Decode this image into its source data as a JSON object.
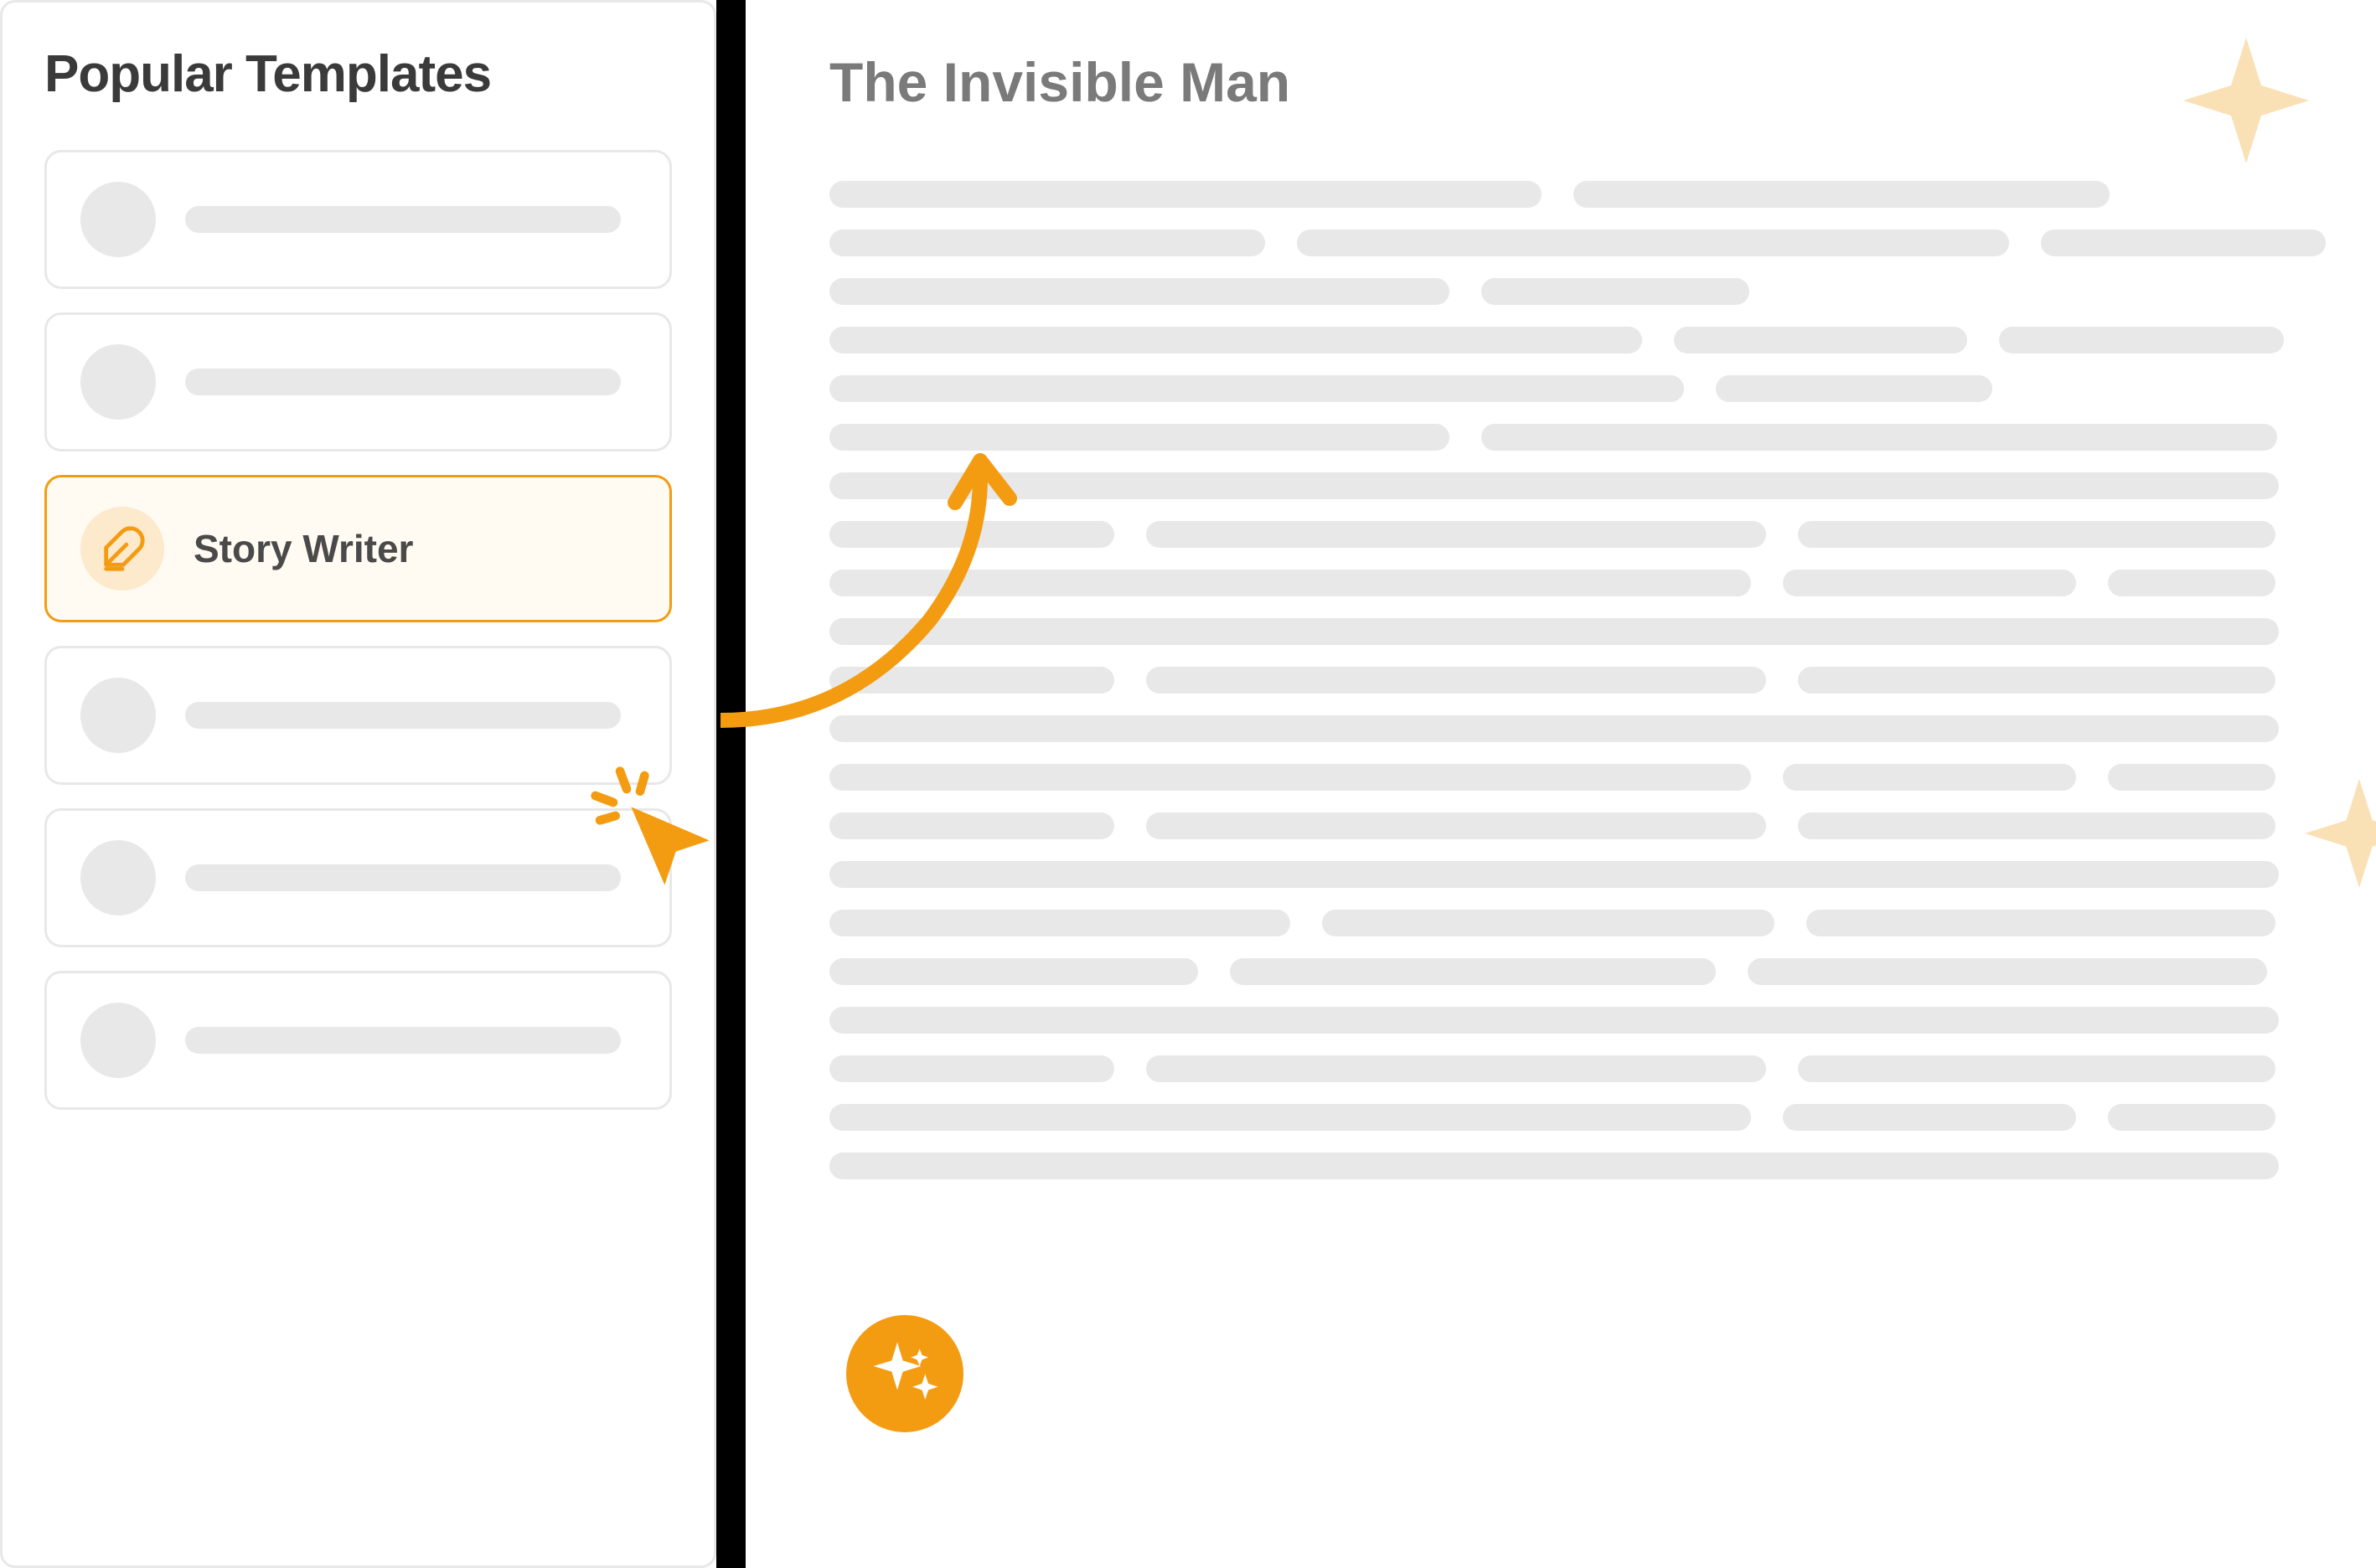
{
  "sidebar": {
    "title": "Popular Templates",
    "items": [
      {
        "label": "",
        "active": false
      },
      {
        "label": "",
        "active": false
      },
      {
        "label": "Story Writer",
        "active": true,
        "icon": "feather-quill-icon"
      },
      {
        "label": "",
        "active": false
      },
      {
        "label": "",
        "active": false
      },
      {
        "label": "",
        "active": false
      }
    ]
  },
  "content": {
    "title": "The Invisible Man"
  },
  "colors": {
    "accent": "#f39c12",
    "accent_light": "#fde9cc",
    "placeholder": "#e8e8e8",
    "star_cream": "#fae0b5",
    "text_dark": "#3a3a3a",
    "text_muted": "#7a7a7a"
  },
  "icons": {
    "cursor": "cursor-click-icon",
    "arrow": "curved-arrow-icon",
    "sparkle": "sparkle-icon",
    "star": "four-point-star-icon",
    "quill": "feather-quill-icon"
  }
}
